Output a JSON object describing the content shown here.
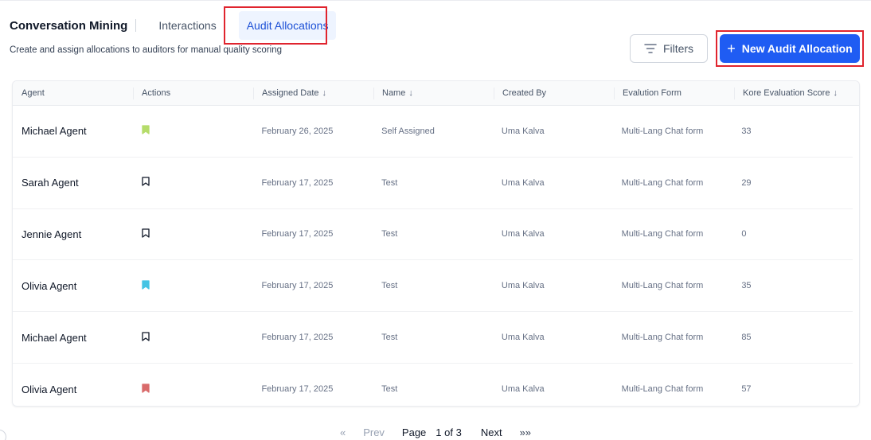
{
  "header": {
    "app_title": "Conversation Mining",
    "tabs": [
      {
        "label": "Interactions",
        "active": false
      },
      {
        "label": "Audit Allocations",
        "active": true
      }
    ],
    "subtitle": "Create and assign allocations to auditors for manual quality scoring"
  },
  "toolbar": {
    "filters_label": "Filters",
    "filters_icon": "filter-lines-icon",
    "new_allocation_label": "New Audit Allocation",
    "new_allocation_icon": "plus-icon"
  },
  "colors": {
    "accent": "#1f5cf3",
    "highlight_box": "#e0242e",
    "bookmark_green": "#b5dc6a",
    "bookmark_cyan": "#45c4e4",
    "bookmark_red": "#d96b6b"
  },
  "table": {
    "columns": [
      "Agent",
      "Actions",
      "Assigned Date",
      "Name",
      "Created By",
      "Evalution Form",
      "Kore Evaluation Score"
    ],
    "sort_arrow": "↓",
    "rows": [
      {
        "agent": "Michael Agent",
        "bookmark": "green",
        "assigned_date": "February 26, 2025",
        "name": "Self Assigned",
        "created_by": "Uma Kalva",
        "form": "Multi-Lang Chat form",
        "score": "33"
      },
      {
        "agent": "Sarah Agent",
        "bookmark": "outline",
        "assigned_date": "February 17, 2025",
        "name": "Test",
        "created_by": "Uma Kalva",
        "form": "Multi-Lang Chat form",
        "score": "29"
      },
      {
        "agent": "Jennie Agent",
        "bookmark": "outline",
        "assigned_date": "February 17, 2025",
        "name": "Test",
        "created_by": "Uma Kalva",
        "form": "Multi-Lang Chat form",
        "score": "0"
      },
      {
        "agent": "Olivia Agent",
        "bookmark": "cyan",
        "assigned_date": "February 17, 2025",
        "name": "Test",
        "created_by": "Uma Kalva",
        "form": "Multi-Lang Chat form",
        "score": "35"
      },
      {
        "agent": "Michael Agent",
        "bookmark": "outline",
        "assigned_date": "February 17, 2025",
        "name": "Test",
        "created_by": "Uma Kalva",
        "form": "Multi-Lang Chat form",
        "score": "85"
      },
      {
        "agent": "Olivia Agent",
        "bookmark": "red",
        "assigned_date": "February 17, 2025",
        "name": "Test",
        "created_by": "Uma Kalva",
        "form": "Multi-Lang Chat form",
        "score": "57"
      }
    ]
  },
  "pagination": {
    "first": "«",
    "prev": "Prev",
    "page_label": "Page",
    "page_count": "1 of 3",
    "next": "Next",
    "last": "»»"
  }
}
